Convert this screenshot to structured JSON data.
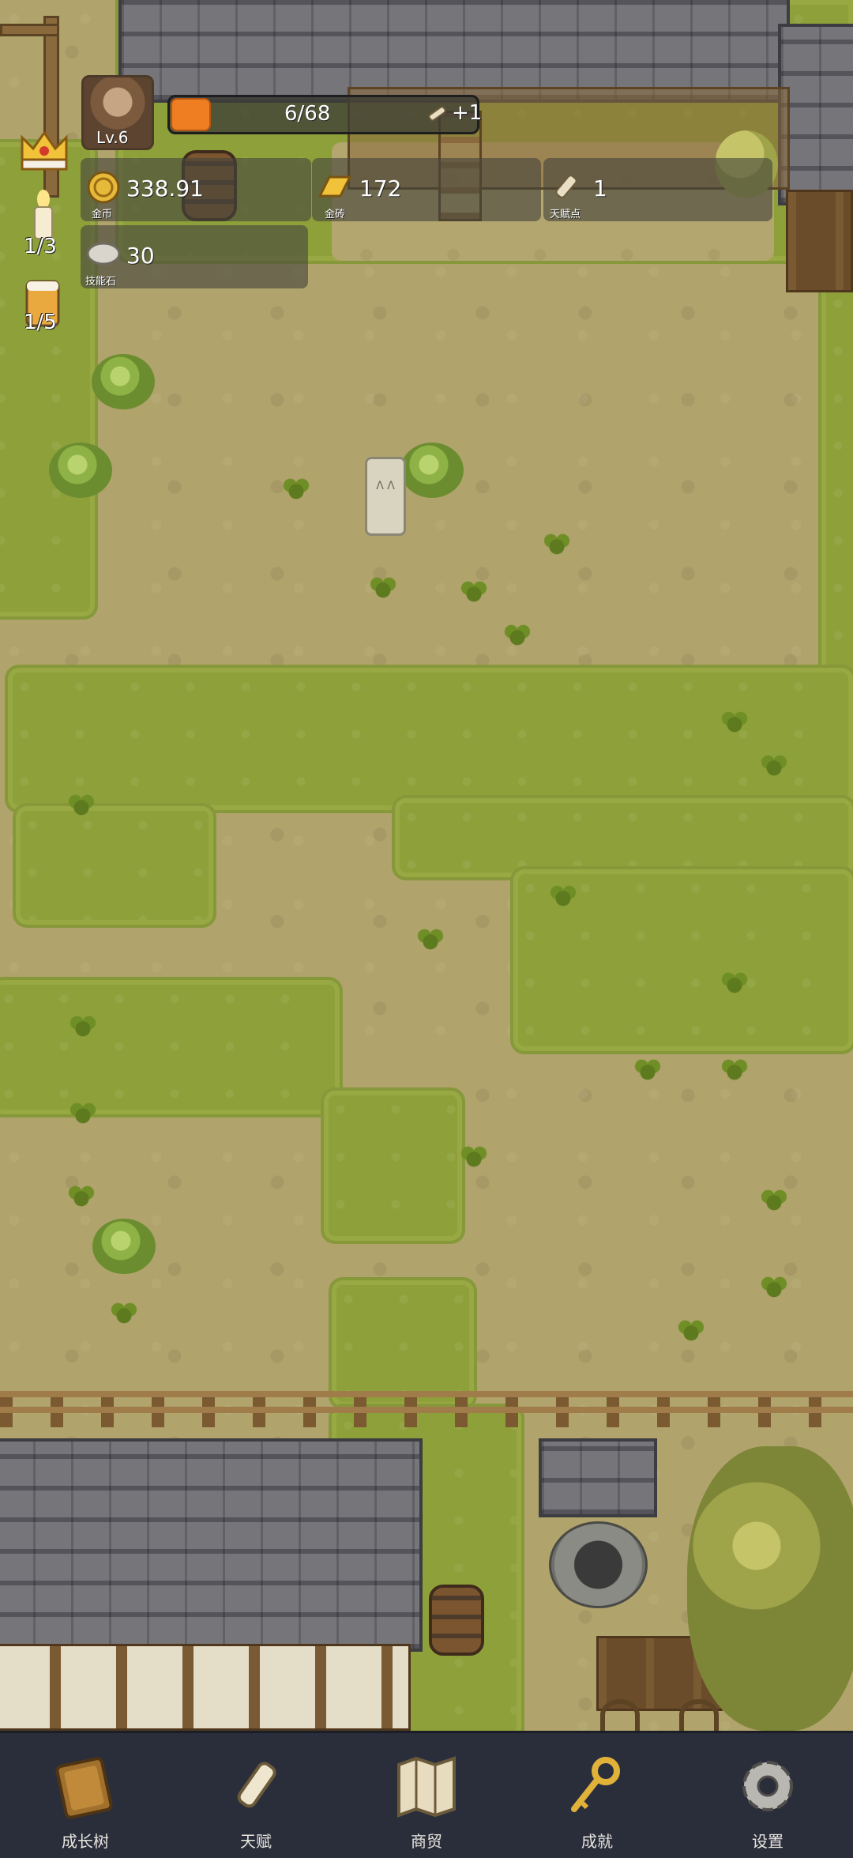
{
  "player": {
    "level": "Lv.6"
  },
  "xp": {
    "text": "6/68",
    "bonus": "+1",
    "fraction": 0.088
  },
  "resources": [
    {
      "label": "金币",
      "value": "338.91",
      "icon": "gold-coin-icon"
    },
    {
      "label": "金砖",
      "value": "172",
      "icon": "gold-bar-icon"
    },
    {
      "label": "天赋点",
      "value": "1",
      "icon": "talent-scroll-icon"
    },
    {
      "label": "技能石",
      "value": "30",
      "icon": "skill-stone-icon"
    }
  ],
  "side": {
    "candle": "1/3",
    "beer": "1/5"
  },
  "nav": [
    {
      "label": "成长树",
      "icon": "growth-book-icon"
    },
    {
      "label": "天赋",
      "icon": "talent-scroll-icon"
    },
    {
      "label": "商贸",
      "icon": "trade-map-icon"
    },
    {
      "label": "成就",
      "icon": "achievement-key-icon"
    },
    {
      "label": "设置",
      "icon": "settings-gear-icon"
    }
  ],
  "colors": {
    "nav_bg": "#2a2e3b",
    "grass": "#8ea03a",
    "dirt": "#b0a36c",
    "xp_fill": "#ef7d22"
  }
}
